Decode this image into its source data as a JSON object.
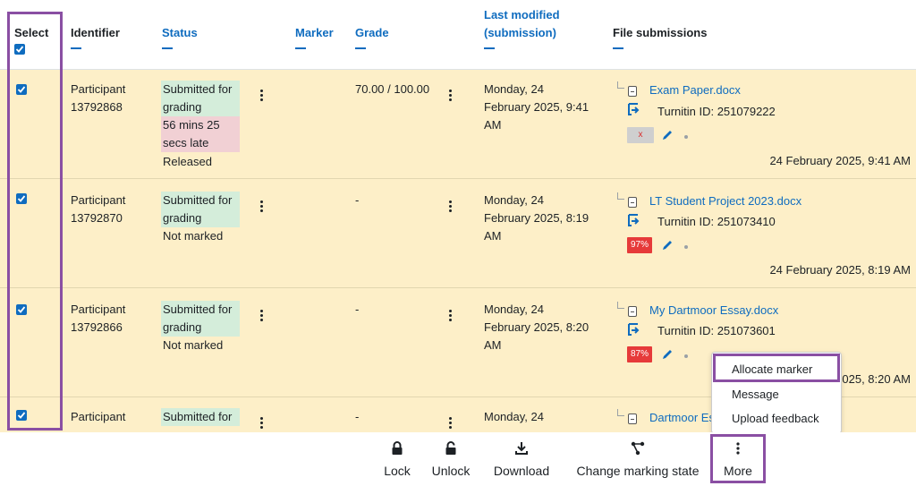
{
  "header": {
    "select": "Select",
    "identifier": "Identifier",
    "status": "Status",
    "marker": "Marker",
    "grade": "Grade",
    "last_modified": "Last modified",
    "last_modified_sub": "(submission)",
    "file_submissions": "File submissions"
  },
  "rows": [
    {
      "participant": "Participant",
      "id": "13792868",
      "status1": "Submitted for",
      "status2": "grading",
      "late1": "56 mins 25",
      "late2": "secs late",
      "extra": "Released",
      "grade": "70.00 / 100.00",
      "modified1": "Monday, 24",
      "modified2": "February 2025, 9:41",
      "modified3": "AM",
      "file": "Exam Paper.docx",
      "turnitin": "Turnitin ID: 251079222",
      "score": "x",
      "date": "24 February 2025, 9:41 AM"
    },
    {
      "participant": "Participant",
      "id": "13792870",
      "status1": "Submitted for",
      "status2": "grading",
      "extra": "Not marked",
      "grade": "-",
      "modified1": "Monday, 24",
      "modified2": "February 2025, 8:19",
      "modified3": "AM",
      "file": "LT Student Project 2023.docx",
      "turnitin": "Turnitin ID: 251073410",
      "score": "97%",
      "date": "24 February 2025, 8:19 AM"
    },
    {
      "participant": "Participant",
      "id": "13792866",
      "status1": "Submitted for",
      "status2": "grading",
      "extra": "Not marked",
      "grade": "-",
      "modified1": "Monday, 24",
      "modified2": "February 2025, 8:20",
      "modified3": "AM",
      "file": "My Dartmoor Essay.docx",
      "turnitin": "Turnitin ID: 251073601",
      "score": "87%",
      "date": "025, 8:20 AM"
    },
    {
      "participant": "Participant",
      "status1": "Submitted for",
      "grade": "-",
      "modified1": "Monday, 24",
      "file": "Dartmoor Es"
    }
  ],
  "menu": {
    "allocate": "Allocate marker",
    "message": "Message",
    "upload": "Upload feedback"
  },
  "footer": {
    "lock": "Lock",
    "unlock": "Unlock",
    "download": "Download",
    "change_state": "Change marking state",
    "more": "More"
  },
  "colors": {
    "accent": "#0f6cbf",
    "row_bg": "#fdefc8",
    "highlight": "#8a4fa3",
    "submitted_bg": "#d4edda",
    "late_bg": "#f1d0d4",
    "similarity_red": "#e63a3a"
  }
}
